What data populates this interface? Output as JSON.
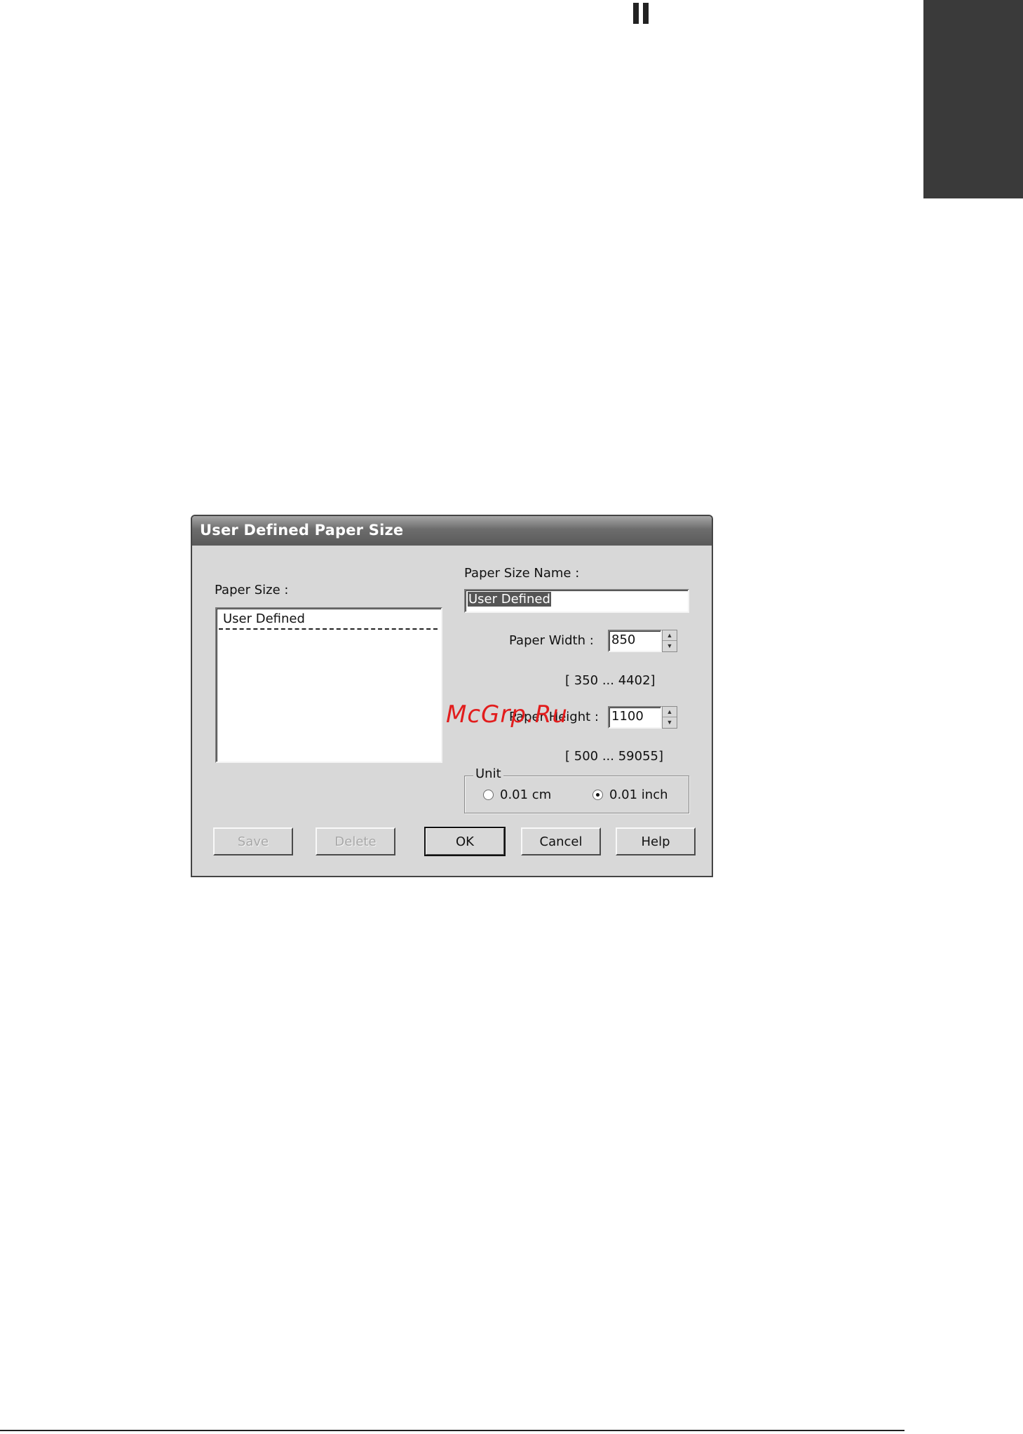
{
  "dialog": {
    "title": "User Defined Paper Size",
    "paper_size": {
      "label": "Paper Size :",
      "items": [
        "User Defined"
      ]
    },
    "paper_size_name": {
      "label": "Paper Size Name :",
      "value": "User Defined"
    },
    "paper_width": {
      "label": "Paper Width :",
      "value": "850",
      "range": "[ 350 ... 4402]"
    },
    "paper_height": {
      "label": "Paper Height :",
      "value": "1100",
      "range": "[ 500 ... 59055]"
    },
    "unit": {
      "label": "Unit",
      "options": [
        {
          "label": "0.01 cm",
          "selected": false
        },
        {
          "label": "0.01 inch",
          "selected": true
        }
      ]
    },
    "buttons": {
      "save": "Save",
      "delete": "Delete",
      "ok": "OK",
      "cancel": "Cancel",
      "help": "Help"
    }
  },
  "watermark": "McGrp.Ru",
  "colors": {
    "dialog_face": "#d8d8d8",
    "titlebar": "#6c6c6c",
    "watermark": "#e21d1d",
    "thumb_tab": "#3a3a3a"
  }
}
